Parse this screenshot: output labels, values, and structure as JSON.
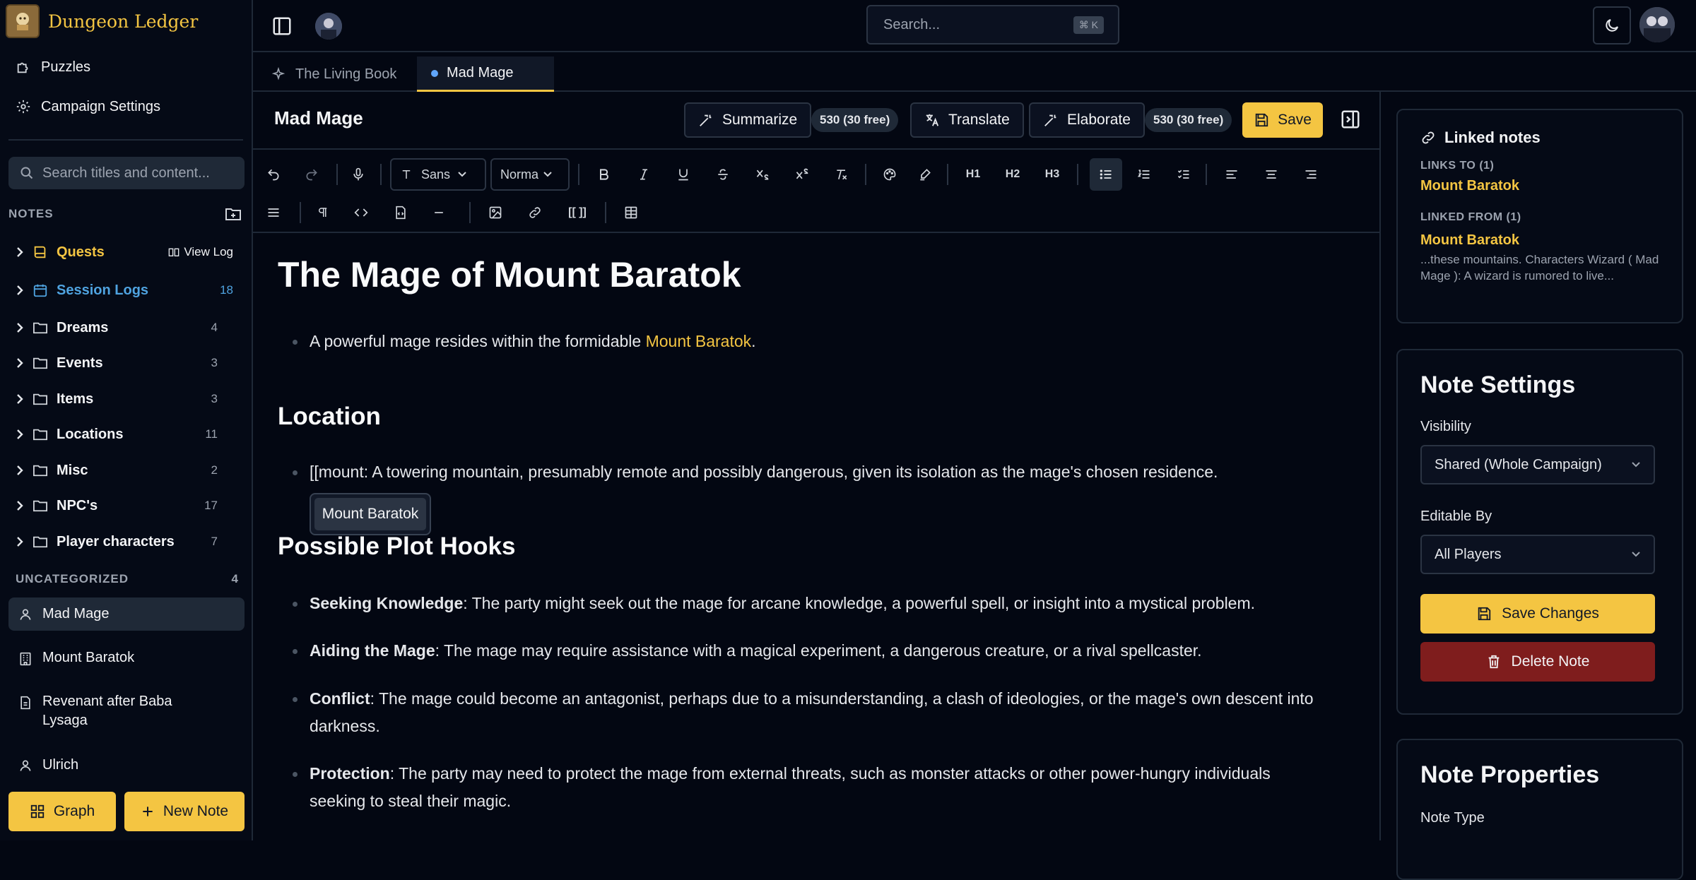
{
  "brand": {
    "name": "Dungeon Ledger"
  },
  "sidebar": {
    "links": [
      {
        "label": "Puzzles",
        "icon": "puzzle-icon"
      },
      {
        "label": "Campaign Settings",
        "icon": "gear-icon"
      }
    ],
    "search_placeholder": "Search titles and content...",
    "notes_heading": "NOTES",
    "tree": [
      {
        "label": "Quests",
        "action": "View Log",
        "style": "gold",
        "icon": "book-icon"
      },
      {
        "label": "Session Logs",
        "count": "18",
        "style": "blue",
        "icon": "calendar-icon"
      },
      {
        "label": "Dreams",
        "count": "4",
        "icon": "folder-icon"
      },
      {
        "label": "Events",
        "count": "3",
        "icon": "folder-icon"
      },
      {
        "label": "Items",
        "count": "3",
        "icon": "folder-icon"
      },
      {
        "label": "Locations",
        "count": "11",
        "icon": "folder-icon"
      },
      {
        "label": "Misc",
        "count": "2",
        "icon": "folder-icon"
      },
      {
        "label": "NPC's",
        "count": "17",
        "icon": "folder-icon"
      },
      {
        "label": "Player characters",
        "count": "7",
        "icon": "folder-icon"
      }
    ],
    "uncategorized": {
      "heading": "UNCATEGORIZED",
      "count": "4"
    },
    "notes": [
      {
        "label": "Mad Mage",
        "icon": "user-icon"
      },
      {
        "label": "Mount Baratok",
        "icon": "building-icon"
      },
      {
        "label": "Revenant after Baba Lysaga",
        "icon": "document-icon"
      },
      {
        "label": "Ulrich",
        "icon": "user-icon"
      }
    ],
    "graph_button": "Graph",
    "new_note_button": "New Note"
  },
  "topbar": {
    "search_placeholder": "Search...",
    "shortcut": "⌘ K"
  },
  "tabs": [
    {
      "label": "The Living Book"
    },
    {
      "label": "Mad Mage"
    }
  ],
  "editor": {
    "note_title": "Mad Mage",
    "summarize": "Summarize",
    "credits": "530 (30 free)",
    "translate": "Translate",
    "elaborate": "Elaborate",
    "save": "Save",
    "font_family": "Sans",
    "text_style": "Norma",
    "h1": "H1",
    "h2": "H2",
    "h3": "H3"
  },
  "doc": {
    "title": "The Mage of Mount Baratok",
    "intro_before": "A powerful mage resides within the formidable ",
    "intro_link": "Mount Baratok",
    "intro_after": ".",
    "location_heading": "Location",
    "location_text": "[[mount: A towering mountain, presumably remote and possibly dangerous, given its isolation as the mage's chosen residence.",
    "suggestion": "Mount Baratok",
    "hooks_heading": "Possible Plot Hooks",
    "hooks": [
      {
        "term": "Seeking Knowledge",
        "text": ": The party might seek out the mage for arcane knowledge, a powerful spell, or insight into a mystical problem."
      },
      {
        "term": "Aiding the Mage",
        "text": ": The mage may require assistance with a magical experiment, a dangerous creature, or a rival spellcaster."
      },
      {
        "term": "Conflict",
        "text": ": The mage could become an antagonist, perhaps due to a misunderstanding, a clash of ideologies, or the mage's own descent into darkness."
      },
      {
        "term": "Protection",
        "text": ": The party may need to protect the mage from external threats, such as monster attacks or other power-hungry individuals seeking to steal their magic."
      }
    ]
  },
  "linked": {
    "heading": "Linked notes",
    "links_to_label": "LINKS TO (1)",
    "links_to": "Mount Baratok",
    "linked_from_label": "LINKED FROM (1)",
    "linked_from": "Mount Baratok",
    "excerpt": "...these mountains. Characters Wizard ( Mad Mage ): A wizard is rumored to live..."
  },
  "settings": {
    "heading": "Note Settings",
    "visibility_label": "Visibility",
    "visibility_value": "Shared (Whole Campaign)",
    "editable_label": "Editable By",
    "editable_value": "All Players",
    "save_changes": "Save Changes",
    "delete_note": "Delete Note"
  },
  "properties": {
    "heading": "Note Properties",
    "type_label": "Note Type"
  },
  "colors": {
    "accent": "#f4c542",
    "danger": "#7f1d1d",
    "link_blue": "#4fa3e0"
  }
}
